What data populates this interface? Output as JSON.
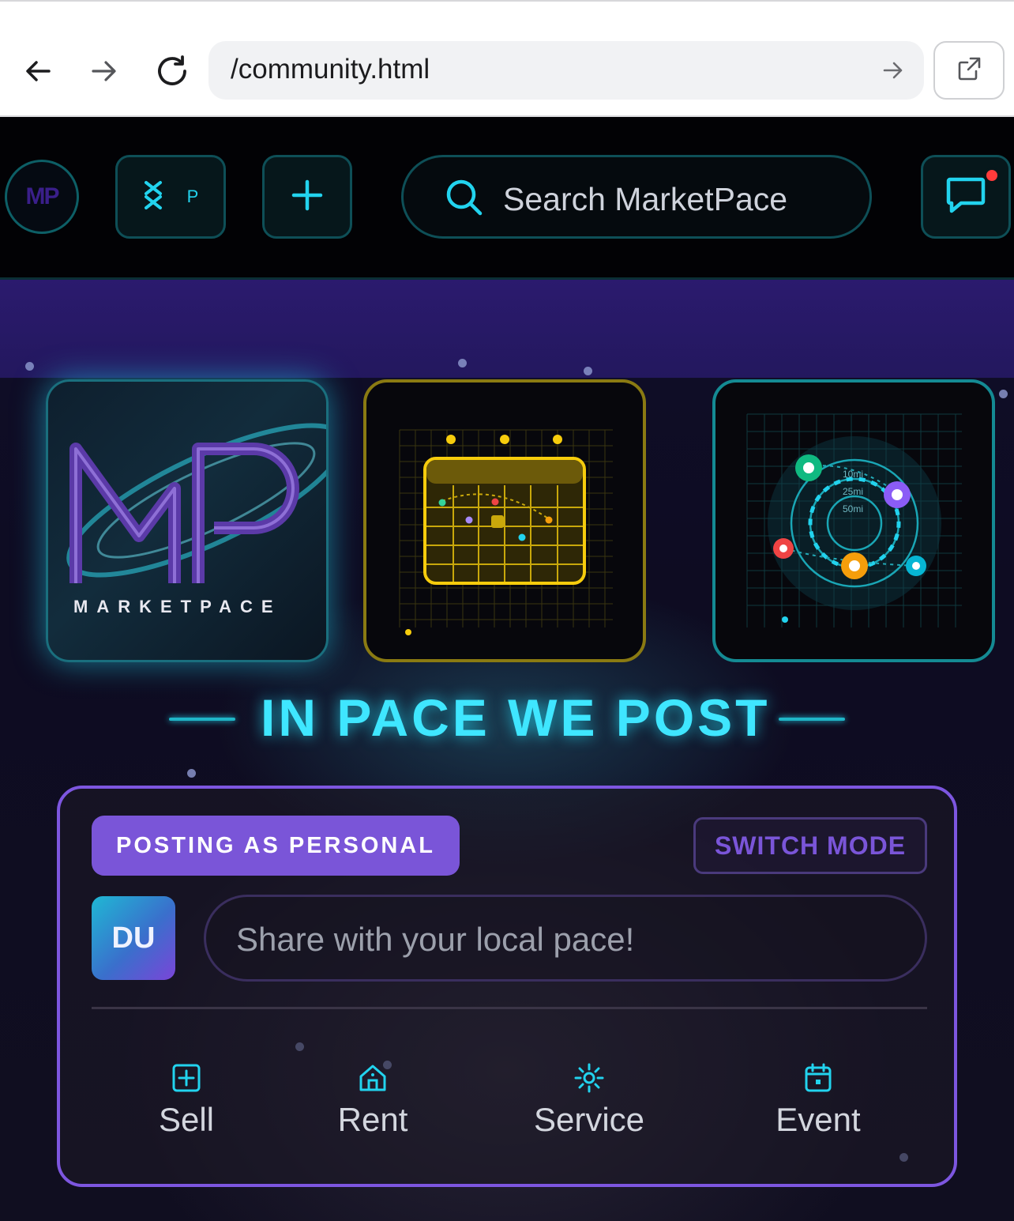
{
  "browser": {
    "url": "/community.html",
    "icons": [
      "back-arrow-icon",
      "forward-arrow-icon",
      "reload-icon",
      "go-arrow-icon",
      "external-link-icon"
    ]
  },
  "header": {
    "logo_text": "MP",
    "pace_label": "P",
    "search_placeholder": "Search MarketPace",
    "icons": [
      "pace-logo-icon",
      "plus-icon",
      "search-icon",
      "chat-icon"
    ],
    "colors": {
      "accent": "#22d3ee",
      "notification": "#ff3b3b"
    }
  },
  "hero": {
    "logo_card": {
      "brand": "MARKETPACE",
      "monogram": "MP"
    },
    "map_card": {
      "rings": [
        "10mi",
        "25mi",
        "50mi"
      ]
    },
    "tagline": "IN PACE WE POST"
  },
  "composer": {
    "mode_badge": "POSTING AS PERSONAL",
    "switch_mode": "SWITCH MODE",
    "avatar_initials": "DU",
    "input_placeholder": "Share with your local pace!",
    "actions": [
      {
        "label": "Sell",
        "icon": "plus-square-icon"
      },
      {
        "label": "Rent",
        "icon": "house-icon"
      },
      {
        "label": "Service",
        "icon": "sun-gear-icon"
      },
      {
        "label": "Event",
        "icon": "calendar-icon"
      }
    ],
    "colors": {
      "accent": "#7a55d8",
      "icon": "#22d3ee"
    }
  }
}
